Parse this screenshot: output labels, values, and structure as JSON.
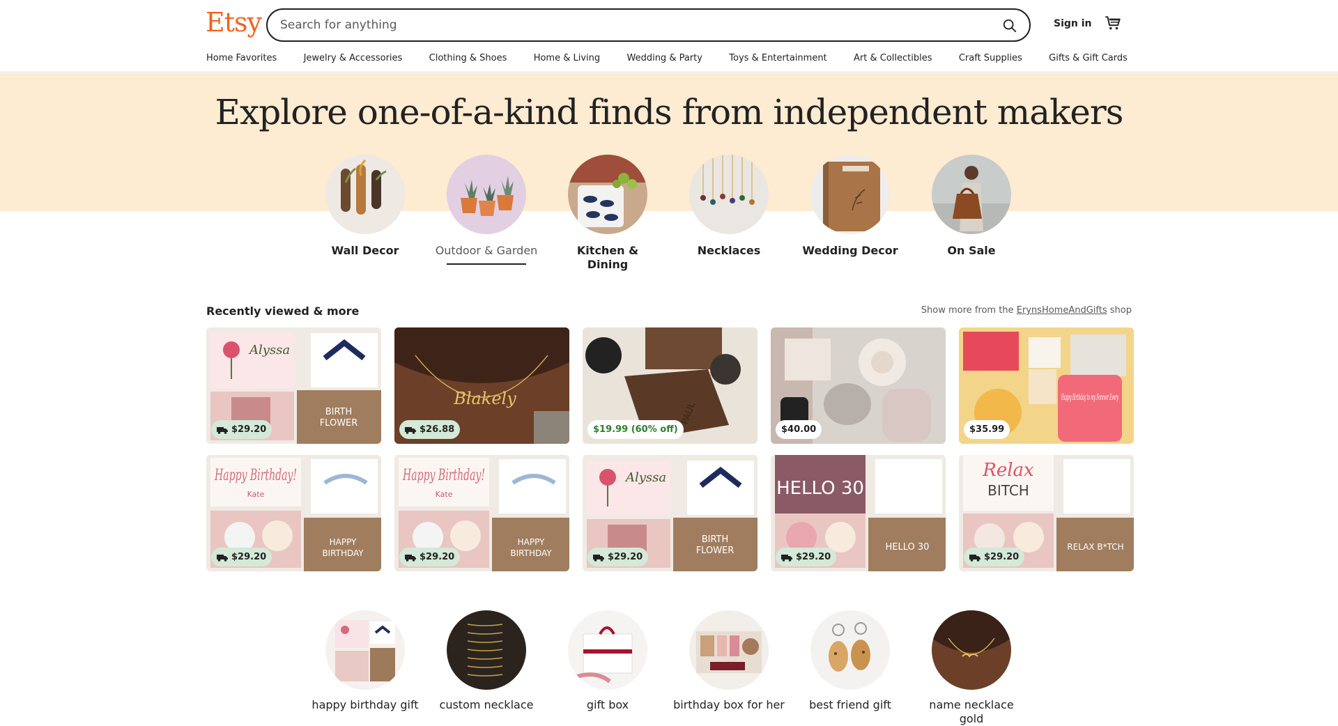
{
  "header": {
    "logo": "Etsy",
    "search_placeholder": "Search for anything",
    "sign_in": "Sign in"
  },
  "nav": [
    "Home Favorites",
    "Jewelry & Accessories",
    "Clothing & Shoes",
    "Home & Living",
    "Wedding & Party",
    "Toys & Entertainment",
    "Art & Collectibles",
    "Craft Supplies",
    "Gifts & Gift Cards"
  ],
  "hero": {
    "title": "Explore one-of-a-kind finds from independent makers",
    "categories": [
      {
        "label": "Wall Decor",
        "active": false
      },
      {
        "label": "Outdoor & Garden",
        "active": true
      },
      {
        "label": "Kitchen & Dining",
        "active": false
      },
      {
        "label": "Necklaces",
        "active": false
      },
      {
        "label": "Wedding Decor",
        "active": false
      },
      {
        "label": "On Sale",
        "active": false
      }
    ]
  },
  "recent": {
    "title": "Recently viewed & more",
    "show_more_prefix": "Show more from the",
    "shop_name": "ErynsHomeAndGifts",
    "show_more_suffix": "shop",
    "items": [
      {
        "price": "$29.20",
        "free_ship": true,
        "sale": false,
        "theme": "birth-flower",
        "card_line1": "BIRTH",
        "card_line2": "FLOWER",
        "name_text": "Alyssa"
      },
      {
        "price": "$26.88",
        "free_ship": true,
        "sale": false,
        "theme": "necklace",
        "name_text": "Blakely"
      },
      {
        "price": "$19.99 (60% off)",
        "free_ship": false,
        "sale": true,
        "theme": "wallet",
        "name_text": "PAUL"
      },
      {
        "price": "$40.00",
        "free_ship": false,
        "sale": false,
        "theme": "spa-box"
      },
      {
        "price": "$35.99",
        "free_ship": false,
        "sale": false,
        "theme": "birthday-jar",
        "jar_text": "Happy Birthday to my Forever Every"
      },
      {
        "price": "$29.20",
        "free_ship": true,
        "sale": false,
        "theme": "happy-birthday",
        "card_line1": "HAPPY",
        "card_line2": "BIRTHDAY",
        "script_text": "Happy Birthday!",
        "name_text": "Kate"
      },
      {
        "price": "$29.20",
        "free_ship": true,
        "sale": false,
        "theme": "happy-birthday",
        "card_line1": "HAPPY",
        "card_line2": "BIRTHDAY",
        "script_text": "Happy Birthday!",
        "name_text": "Kate"
      },
      {
        "price": "$29.20",
        "free_ship": true,
        "sale": false,
        "theme": "birth-flower",
        "card_line1": "BIRTH",
        "card_line2": "FLOWER",
        "name_text": "Alyssa"
      },
      {
        "price": "$29.20",
        "free_ship": true,
        "sale": false,
        "theme": "hello-30",
        "card_line1": "HELLO 30",
        "script_text": "HELLO 30"
      },
      {
        "price": "$29.20",
        "free_ship": true,
        "sale": false,
        "theme": "relax",
        "card_line1": "RELAX B*TCH",
        "script_text": "Relax",
        "name_text": "BITCH"
      }
    ]
  },
  "searches": [
    {
      "label": "happy birthday gift"
    },
    {
      "label": "custom necklace"
    },
    {
      "label": "gift box"
    },
    {
      "label": "birthday box for her"
    },
    {
      "label": "best friend gift"
    },
    {
      "label": "name necklace gold"
    }
  ],
  "colors": {
    "brand": "#F1641E",
    "hero_bg": "#FDEBD2",
    "badge_green": "#D4E9D7",
    "sale_green": "#2E7D32"
  }
}
